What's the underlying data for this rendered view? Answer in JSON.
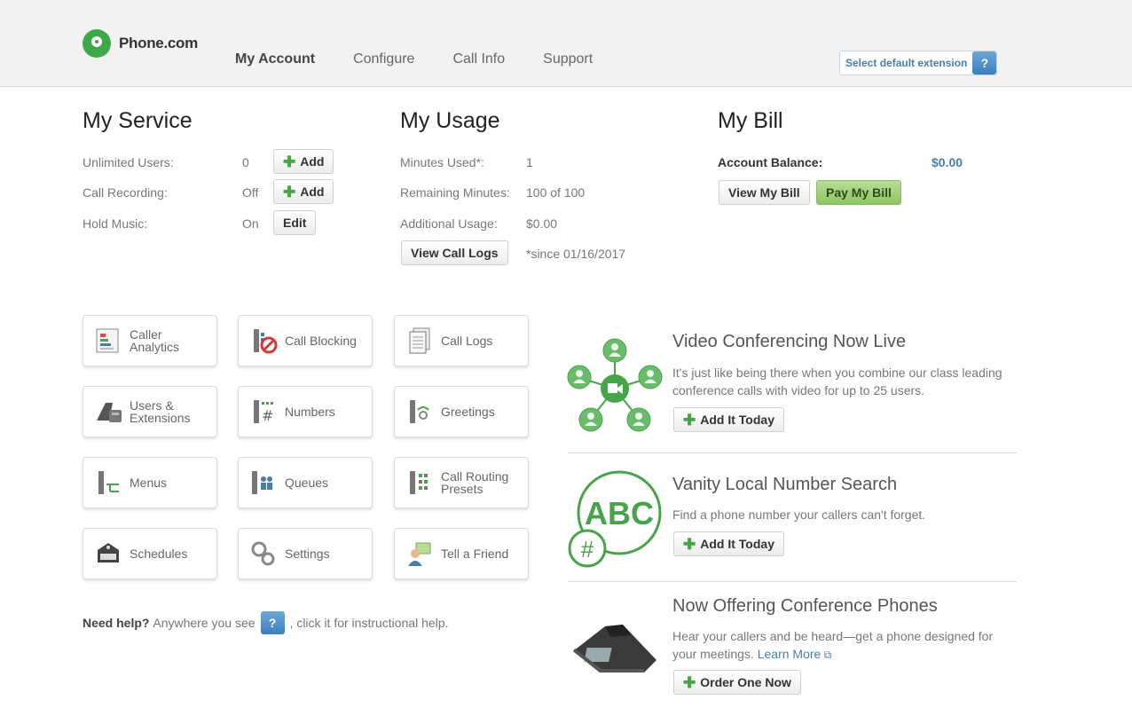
{
  "header": {
    "logo_text": "Phone.com",
    "nav": [
      "My Account",
      "Configure",
      "Call Info",
      "Support"
    ],
    "extension_select": "Select default extension",
    "help_label": "?"
  },
  "my_service": {
    "title": "My Service",
    "rows": [
      {
        "label": "Unlimited Users:",
        "value": "0",
        "button": "Add"
      },
      {
        "label": "Call Recording:",
        "value": "Off",
        "button": "Add"
      },
      {
        "label": "Hold Music:",
        "value": "On",
        "button": "Edit"
      }
    ]
  },
  "my_usage": {
    "title": "My Usage",
    "rows": [
      {
        "label": "Minutes Used*:",
        "value": "1"
      },
      {
        "label": "Remaining Minutes:",
        "value": "100 of 100"
      },
      {
        "label": "Additional Usage:",
        "value": "$0.00"
      }
    ],
    "view_logs_button": "View Call Logs",
    "since": "*since 01/16/2017"
  },
  "my_bill": {
    "title": "My Bill",
    "balance_label": "Account Balance:",
    "balance_value": "$0.00",
    "view_button": "View My Bill",
    "pay_button": "Pay My Bill"
  },
  "tiles": [
    {
      "label": "Caller\nAnalytics",
      "icon": "caller-analytics-icon"
    },
    {
      "label": "Call Blocking",
      "icon": "call-blocking-icon"
    },
    {
      "label": "Call Logs",
      "icon": "call-logs-icon"
    },
    {
      "label": "Users &\nExtensions",
      "icon": "users-extensions-icon"
    },
    {
      "label": "Numbers",
      "icon": "numbers-icon"
    },
    {
      "label": "Greetings",
      "icon": "greetings-icon"
    },
    {
      "label": "Menus",
      "icon": "menus-icon"
    },
    {
      "label": "Queues",
      "icon": "queues-icon"
    },
    {
      "label": "Call Routing\nPresets",
      "icon": "call-routing-icon"
    },
    {
      "label": "Schedules",
      "icon": "schedules-icon"
    },
    {
      "label": "Settings",
      "icon": "settings-icon"
    },
    {
      "label": "Tell a Friend",
      "icon": "tell-a-friend-icon"
    }
  ],
  "help": {
    "bold": "Need help?",
    "before": "Anywhere you see",
    "after": ", click it for instructional help."
  },
  "promos": [
    {
      "title": "Video Conferencing Now Live",
      "desc": "It's just like being there when you combine our class leading conference calls with video for up to 25 users.",
      "button": "Add It Today"
    },
    {
      "title": "Vanity Local Number Search",
      "desc": "Find a phone number your callers can't forget.",
      "button": "Add It Today",
      "icon_text": "ABC",
      "icon_hash": "#"
    },
    {
      "title": "Now Offering Conference Phones",
      "desc": "Hear your callers and be heard—get a phone designed for your meetings.",
      "link": "Learn More",
      "button": "Order One Now"
    }
  ],
  "colors": {
    "brand_green": "#3da94b",
    "link_blue": "#4a7eaa"
  }
}
